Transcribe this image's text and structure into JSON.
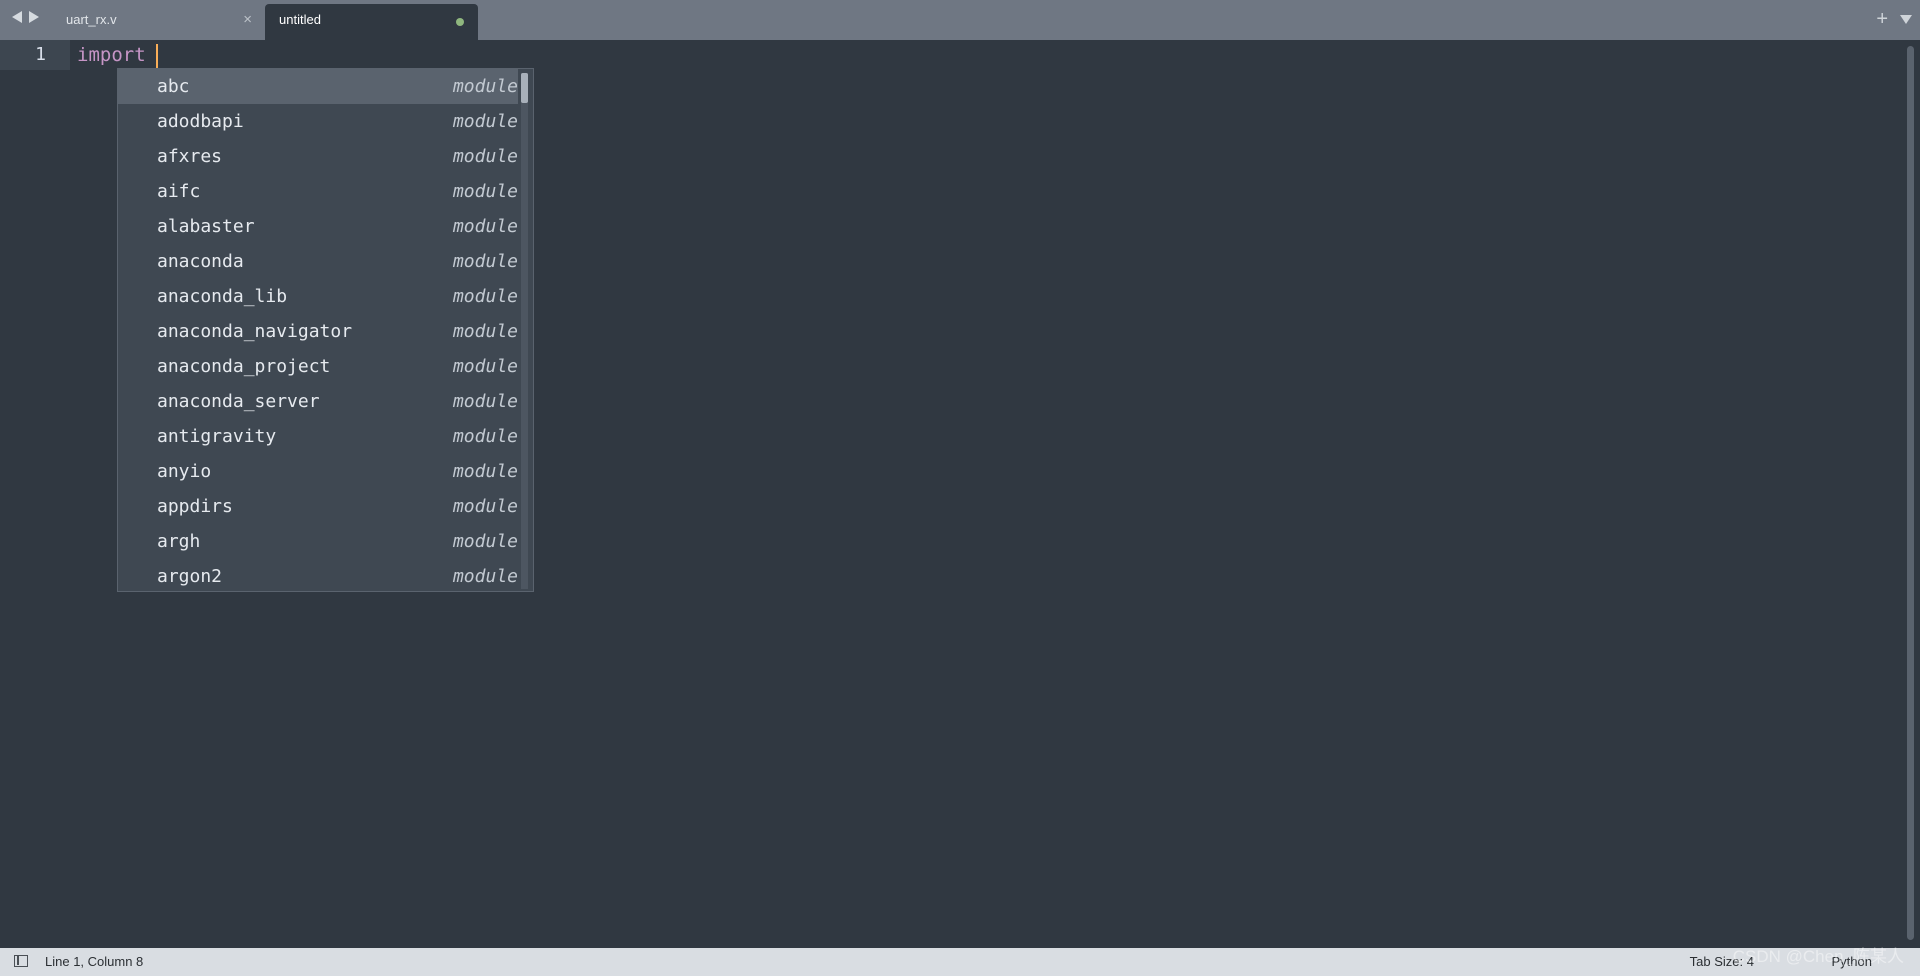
{
  "tabs": [
    {
      "label": "uart_rx.v",
      "close": "×"
    },
    {
      "label": "untitled",
      "dirty": true
    }
  ],
  "tabbar": {
    "add": "+"
  },
  "editor": {
    "line_number": "1",
    "keyword": "import",
    "cursor_after": " "
  },
  "autocomplete": {
    "items": [
      {
        "name": "abc",
        "kind": "module",
        "selected": true
      },
      {
        "name": "adodbapi",
        "kind": "module"
      },
      {
        "name": "afxres",
        "kind": "module"
      },
      {
        "name": "aifc",
        "kind": "module"
      },
      {
        "name": "alabaster",
        "kind": "module"
      },
      {
        "name": "anaconda",
        "kind": "module"
      },
      {
        "name": "anaconda_lib",
        "kind": "module"
      },
      {
        "name": "anaconda_navigator",
        "kind": "module"
      },
      {
        "name": "anaconda_project",
        "kind": "module"
      },
      {
        "name": "anaconda_server",
        "kind": "module"
      },
      {
        "name": "antigravity",
        "kind": "module"
      },
      {
        "name": "anyio",
        "kind": "module"
      },
      {
        "name": "appdirs",
        "kind": "module"
      },
      {
        "name": "argh",
        "kind": "module"
      },
      {
        "name": "argon2",
        "kind": "module"
      }
    ]
  },
  "statusbar": {
    "position": "Line 1, Column 8",
    "tab_size": "Tab Size: 4",
    "syntax": "Python"
  },
  "watermark": "CSDN @Chen_陈某人",
  "colors": {
    "background": "#303841",
    "tabbar": "#6f7783",
    "keyword": "#c695c6",
    "caret": "#f9ae58",
    "dirty_dot": "#8fb77e"
  }
}
